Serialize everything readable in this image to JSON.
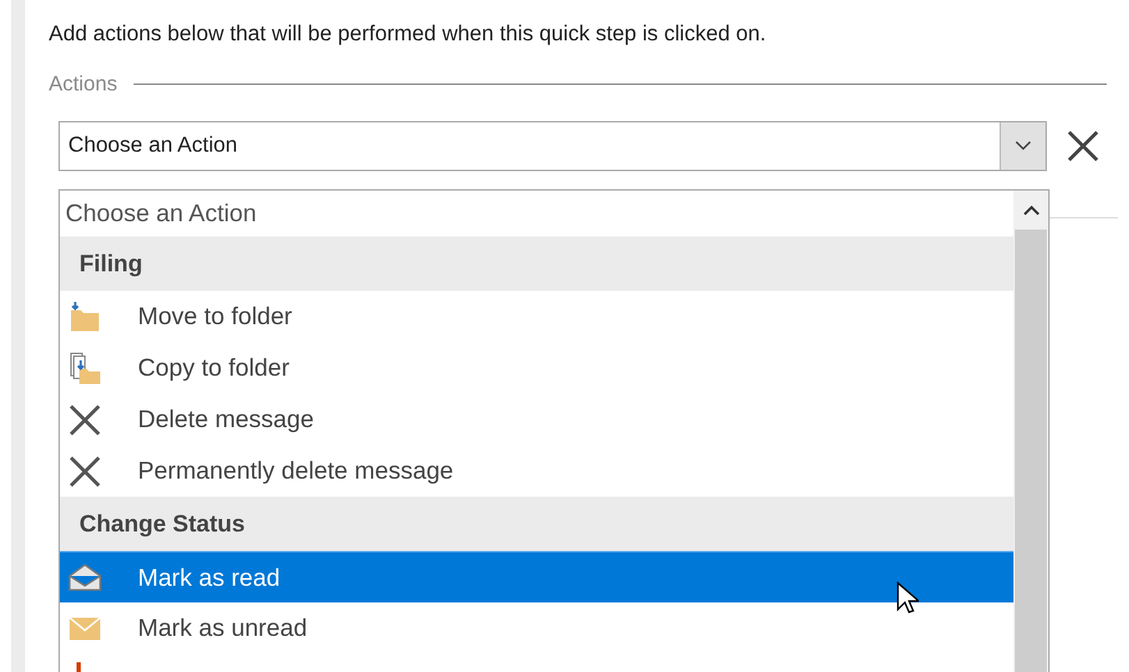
{
  "instruction": "Add actions below that will be performed when this quick step is clicked on.",
  "section_label": "Actions",
  "action_combo": {
    "value": "Choose an Action"
  },
  "dropdown": {
    "items": [
      {
        "kind": "placeholder",
        "label": "Choose an Action",
        "selected": false
      },
      {
        "kind": "header",
        "label": "Filing"
      },
      {
        "kind": "move",
        "label": "Move to folder",
        "selected": false
      },
      {
        "kind": "copy",
        "label": "Copy to folder",
        "selected": false
      },
      {
        "kind": "delete",
        "label": "Delete message",
        "selected": false
      },
      {
        "kind": "delete",
        "label": "Permanently delete message",
        "selected": false
      },
      {
        "kind": "header",
        "label": "Change Status"
      },
      {
        "kind": "read",
        "label": "Mark as read",
        "selected": true
      },
      {
        "kind": "unread",
        "label": "Mark as unread",
        "selected": false
      },
      {
        "kind": "flag"
      }
    ]
  }
}
